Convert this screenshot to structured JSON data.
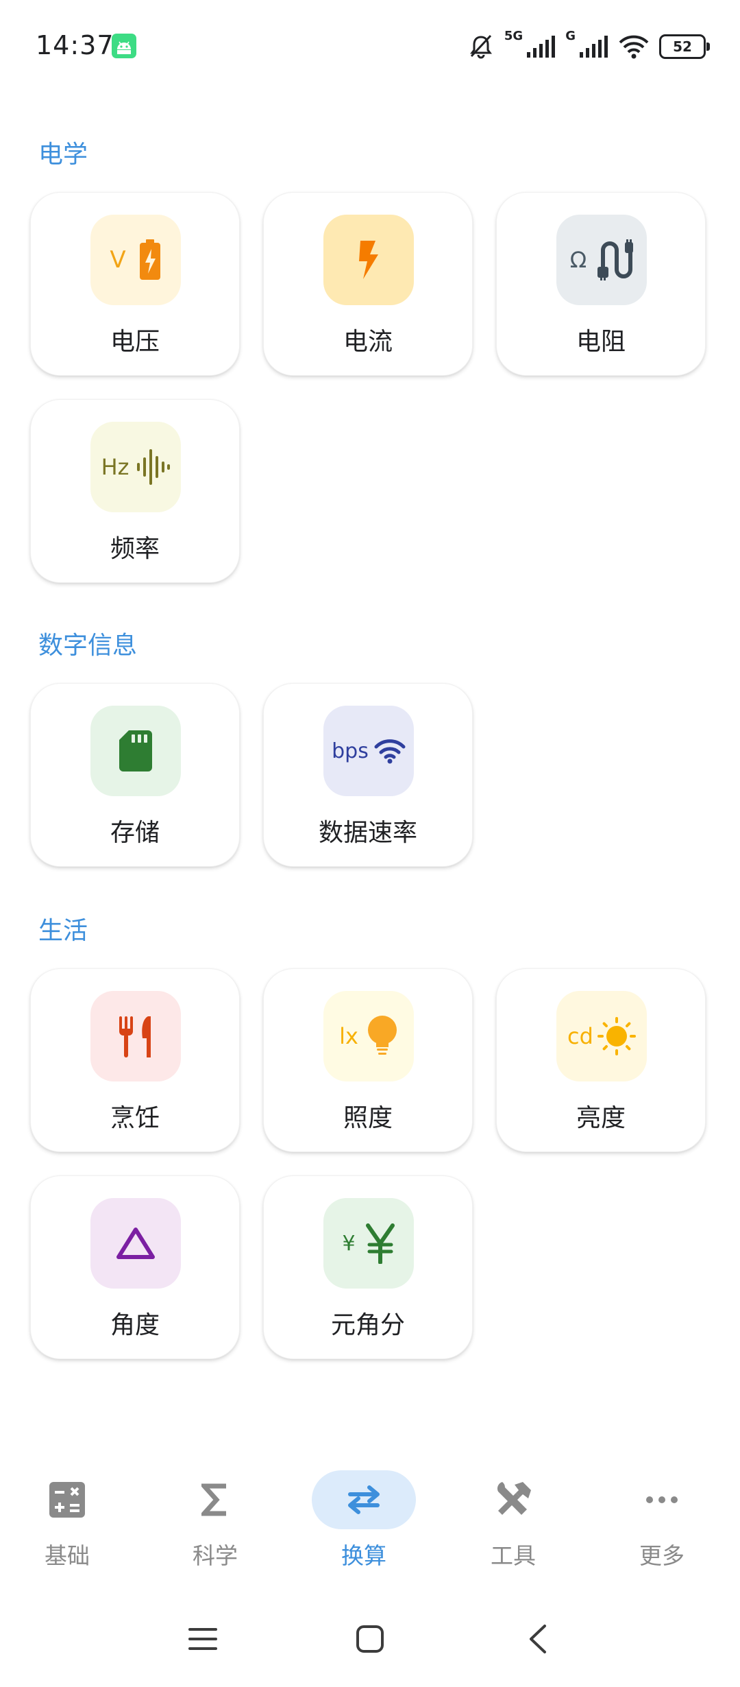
{
  "status_bar": {
    "time": "14:37",
    "signal_1": "5G",
    "signal_2": "G",
    "battery": "52"
  },
  "sections": {
    "electric": {
      "title": "电学",
      "items": {
        "voltage": {
          "label": "电压",
          "unit": "V",
          "icon": "battery-bolt-icon"
        },
        "current": {
          "label": "电流",
          "icon": "bolt-icon"
        },
        "resistance": {
          "label": "电阻",
          "unit": "Ω",
          "icon": "cable-icon"
        },
        "frequency": {
          "label": "频率",
          "unit": "Hz",
          "icon": "waveform-icon"
        }
      }
    },
    "digital": {
      "title": "数字信息",
      "items": {
        "storage": {
          "label": "存储",
          "icon": "sd-card-icon"
        },
        "data_rate": {
          "label": "数据速率",
          "unit": "bps",
          "icon": "wifi-icon"
        }
      }
    },
    "life": {
      "title": "生活",
      "items": {
        "cooking": {
          "label": "烹饪",
          "icon": "fork-knife-icon"
        },
        "illuminance": {
          "label": "照度",
          "unit": "lx",
          "icon": "lightbulb-icon"
        },
        "luminance": {
          "label": "亮度",
          "unit": "cd",
          "icon": "sun-icon"
        },
        "angle": {
          "label": "角度",
          "icon": "triangle-icon"
        },
        "yuan": {
          "label": "元角分",
          "unit": "¥",
          "icon": "yuan-icon"
        }
      }
    }
  },
  "bottom_nav": {
    "basic": "基础",
    "science": "科学",
    "convert": "换算",
    "tools": "工具",
    "more": "更多"
  },
  "colors": {
    "accent": "#3d8fdc",
    "active_pill": "#dcebfb"
  }
}
